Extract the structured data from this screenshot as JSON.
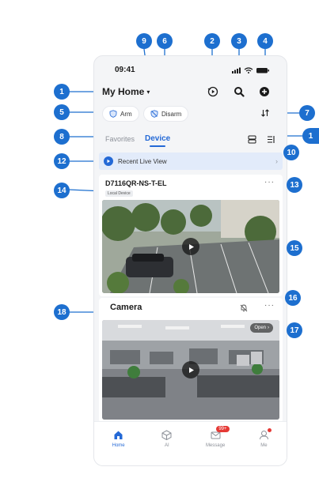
{
  "status_bar": {
    "time": "09:41"
  },
  "header": {
    "title": "My Home",
    "caret": "▾"
  },
  "arm_bar": {
    "arm_label": "Arm",
    "disarm_label": "Disarm"
  },
  "tabs": {
    "favorites": "Favorites",
    "device": "Device"
  },
  "recent_live_view": {
    "label": "Recent Live View",
    "chevron": "›"
  },
  "device_card": {
    "name": "D7116QR-NS-T-EL",
    "badge": "Local Device",
    "more": "···"
  },
  "camera_card": {
    "title": "Camera",
    "more": "···",
    "open_label": "Open",
    "open_chevron": "›"
  },
  "bottom_nav": {
    "items": [
      {
        "label": "Home",
        "icon": "home-icon",
        "active": true
      },
      {
        "label": "AI",
        "icon": "cube-icon"
      },
      {
        "label": "Message",
        "icon": "mail-icon",
        "badge": "99+"
      },
      {
        "label": "Me",
        "icon": "user-icon",
        "dot": true
      }
    ]
  },
  "callouts": [
    "1",
    "2",
    "3",
    "4",
    "5",
    "6",
    "7",
    "8",
    "9",
    "10",
    "1",
    "12",
    "13",
    "14",
    "15",
    "16",
    "17",
    "18"
  ],
  "colors": {
    "accent": "#2469d6",
    "callout": "#1d6fcf",
    "badge": "#e53935"
  }
}
